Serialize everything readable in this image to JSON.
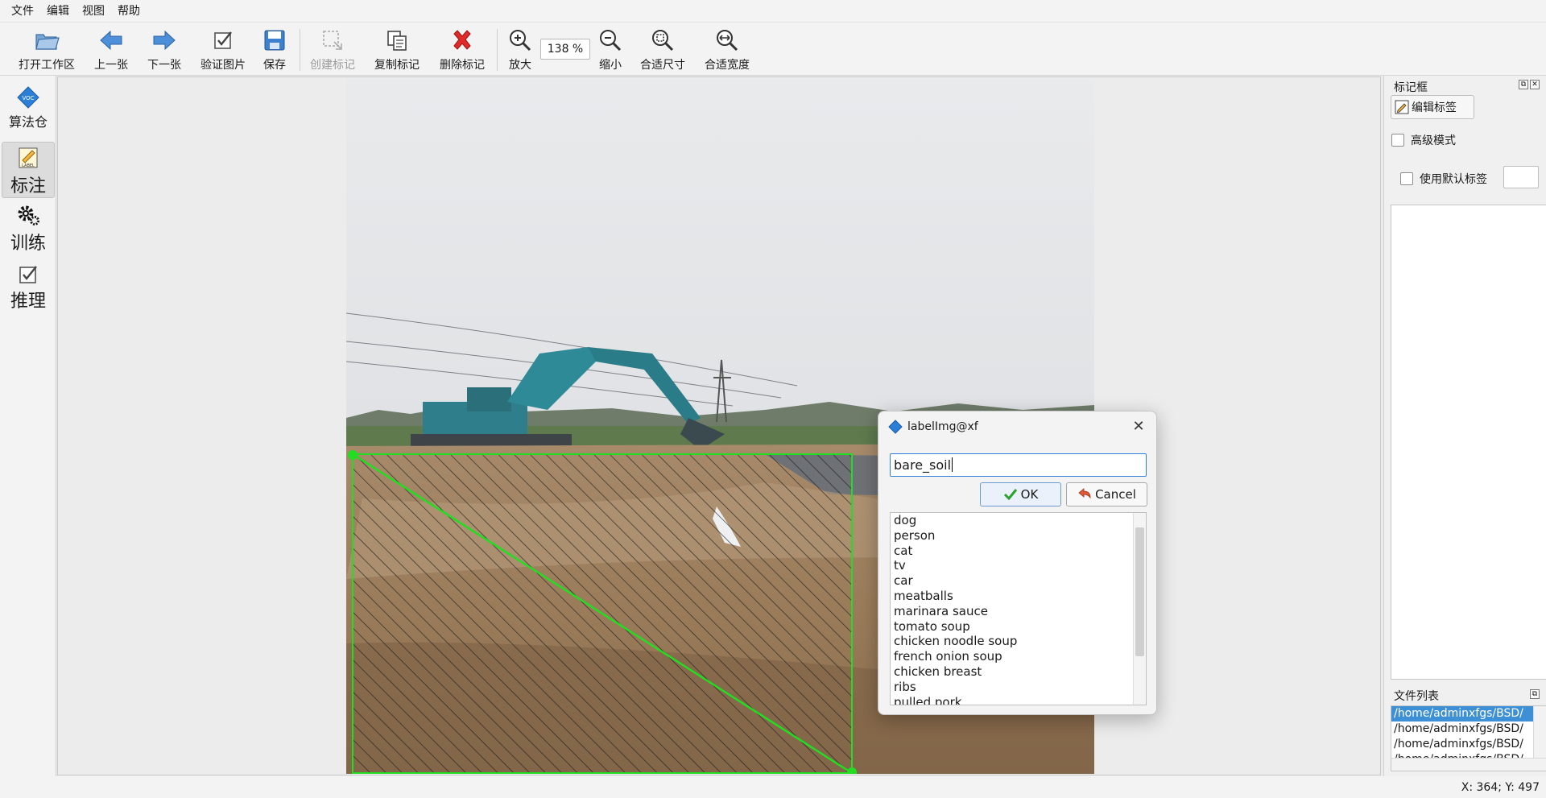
{
  "menu": [
    "文件",
    "编辑",
    "视图",
    "帮助"
  ],
  "toolbar": {
    "open": "打开工作区",
    "prev": "上一张",
    "next": "下一张",
    "verify": "验证图片",
    "save": "保存",
    "create": "创建标记",
    "copy": "复制标记",
    "delete": "删除标记",
    "zoom_in": "放大",
    "zoom_value": "138 %",
    "zoom_out": "缩小",
    "fit_size": "合适尺寸",
    "fit_width": "合适宽度"
  },
  "nav": {
    "algo": "算法仓",
    "annotate": "标注",
    "train": "训练",
    "infer": "推理"
  },
  "right_dock": {
    "box_title": "标记框",
    "edit_label": "编辑标签",
    "advanced_mode": "高级模式",
    "use_default_label": "使用默认标签",
    "file_list_title": "文件列表",
    "files": [
      "/home/adminxfgs/BSD/",
      "/home/adminxfgs/BSD/",
      "/home/adminxfgs/BSD/",
      "/home/adminxfgs/BSD/"
    ]
  },
  "status": {
    "coords": "X: 364; Y: 497"
  },
  "dialog": {
    "title": "labelImg@xf",
    "input_value": "bare_soil",
    "ok": "OK",
    "cancel": "Cancel",
    "labels": [
      "dog",
      "person",
      "cat",
      "tv",
      "car",
      "meatballs",
      "marinara sauce",
      "tomato soup",
      "chicken noodle soup",
      "french onion soup",
      "chicken breast",
      "ribs",
      "pulled pork"
    ]
  },
  "colors": {
    "bbox": "#22dd22",
    "accent": "#2f7fd8",
    "selection": "#3d8fd6"
  }
}
